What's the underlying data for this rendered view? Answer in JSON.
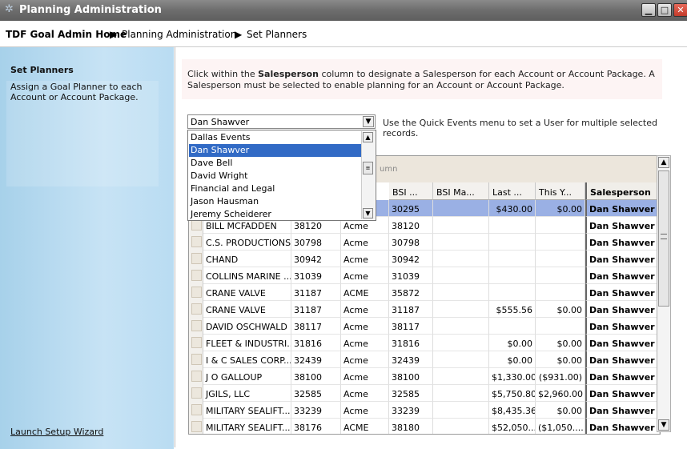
{
  "window": {
    "title": "Planning Administration",
    "icon": "app-icon",
    "minimize": "▁",
    "maximize": "□",
    "close": "✕"
  },
  "breadcrumb": {
    "home": "TDF Goal Admin Home",
    "sep1": "▶",
    "level1": "Planning Administration",
    "sep2": "▶",
    "level2": "Set Planners"
  },
  "sidebar": {
    "title": "Set Planners",
    "description": "Assign a Goal Planner to each Account or Account Package.",
    "wizard_link": "Launch Setup Wizard"
  },
  "instructions": {
    "prefix": "Click within the ",
    "bold": "Salesperson",
    "suffix": " column to designate a Salesperson for each Account or Account Package.  A Salesperson must be selected to enable planning for an Account or Account Package."
  },
  "user_select": {
    "value": "Dan Shawver",
    "options": [
      "Dallas Events",
      "Dan Shawver",
      "Dave Bell",
      "David Wright",
      "Financial and Legal",
      "Jason Hausman",
      "Jeremy Scheiderer"
    ],
    "selected_index": 1
  },
  "quick_note": "Use the Quick Events menu to set a User for multiple selected records.",
  "grid": {
    "group_hint": "umn",
    "columns": [
      "BSI ...",
      "BSI Ma...",
      "Last ...",
      "This Y...",
      "Salesperson"
    ],
    "rows": [
      {
        "name": "",
        "num": "",
        "co": "",
        "bsi": "30295",
        "bsim": "",
        "last": "$430.00",
        "this": "$0.00",
        "sp": "Dan Shawver",
        "selected": true
      },
      {
        "name": "BILL MCFADDEN",
        "num": "38120",
        "co": "Acme",
        "bsi": "38120",
        "bsim": "",
        "last": "",
        "this": "",
        "sp": "Dan Shawver"
      },
      {
        "name": "C.S. PRODUCTIONS",
        "num": "30798",
        "co": "Acme",
        "bsi": "30798",
        "bsim": "",
        "last": "",
        "this": "",
        "sp": "Dan Shawver"
      },
      {
        "name": "CHAND",
        "num": "30942",
        "co": "Acme",
        "bsi": "30942",
        "bsim": "",
        "last": "",
        "this": "",
        "sp": "Dan Shawver"
      },
      {
        "name": "COLLINS MARINE ...",
        "num": "31039",
        "co": "Acme",
        "bsi": "31039",
        "bsim": "",
        "last": "",
        "this": "",
        "sp": "Dan Shawver"
      },
      {
        "name": "CRANE VALVE",
        "num": "31187",
        "co": "ACME",
        "bsi": "35872",
        "bsim": "",
        "last": "",
        "this": "",
        "sp": "Dan Shawver"
      },
      {
        "name": "CRANE VALVE",
        "num": "31187",
        "co": "Acme",
        "bsi": "31187",
        "bsim": "",
        "last": "$555.56",
        "this": "$0.00",
        "sp": "Dan Shawver"
      },
      {
        "name": "DAVID OSCHWALD",
        "num": "38117",
        "co": "Acme",
        "bsi": "38117",
        "bsim": "",
        "last": "",
        "this": "",
        "sp": "Dan Shawver"
      },
      {
        "name": "FLEET & INDUSTRI...",
        "num": "31816",
        "co": "Acme",
        "bsi": "31816",
        "bsim": "",
        "last": "$0.00",
        "this": "$0.00",
        "sp": "Dan Shawver"
      },
      {
        "name": "I & C SALES CORP...",
        "num": "32439",
        "co": "Acme",
        "bsi": "32439",
        "bsim": "",
        "last": "$0.00",
        "this": "$0.00",
        "sp": "Dan Shawver"
      },
      {
        "name": "J O GALLOUP",
        "num": "38100",
        "co": "Acme",
        "bsi": "38100",
        "bsim": "",
        "last": "$1,330.00",
        "this": "($931.00)",
        "sp": "Dan Shawver"
      },
      {
        "name": "JGILS, LLC",
        "num": "32585",
        "co": "Acme",
        "bsi": "32585",
        "bsim": "",
        "last": "$5,750.80",
        "this": "$2,960.00",
        "sp": "Dan Shawver"
      },
      {
        "name": "MILITARY SEALIFT...",
        "num": "33239",
        "co": "Acme",
        "bsi": "33239",
        "bsim": "",
        "last": "$8,435.36",
        "this": "$0.00",
        "sp": "Dan Shawver"
      },
      {
        "name": "MILITARY SEALIFT...",
        "num": "38176",
        "co": "ACME",
        "bsi": "38180",
        "bsim": "",
        "last": "$52,050....",
        "this": "($1,050....",
        "sp": "Dan Shawver"
      }
    ]
  }
}
